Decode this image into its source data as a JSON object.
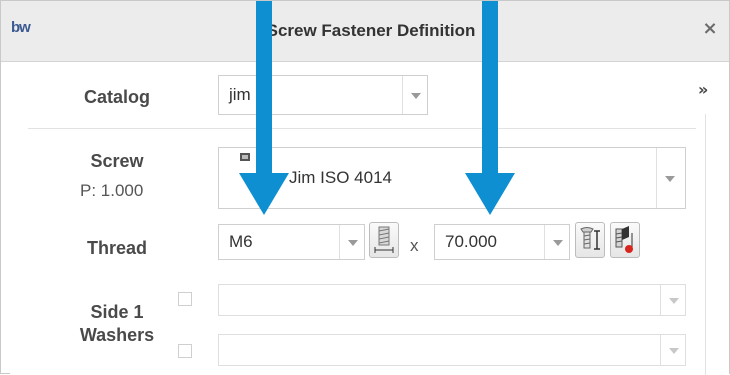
{
  "window": {
    "logo": "bw",
    "title": "Screw Fastener Definition",
    "close_glyph": "×",
    "expand_glyph": "»"
  },
  "catalog": {
    "label": "Catalog",
    "value": "jim"
  },
  "screw": {
    "label": "Screw",
    "p_value": "P: 1.000",
    "value": "Jim ISO 4014"
  },
  "thread": {
    "label": "Thread",
    "size_value": "M6",
    "times": "x",
    "length_value": "70.000"
  },
  "washers": {
    "label_line1": "Side 1",
    "label_line2": "Washers",
    "row1_value": "",
    "row2_value": ""
  },
  "icons": {
    "thread_length_button": "thread-length-icon",
    "screw_measure_button": "screw-measure-icon",
    "screw_pick_button": "screw-pick-icon",
    "arrow_color": "#0e8fd1"
  }
}
